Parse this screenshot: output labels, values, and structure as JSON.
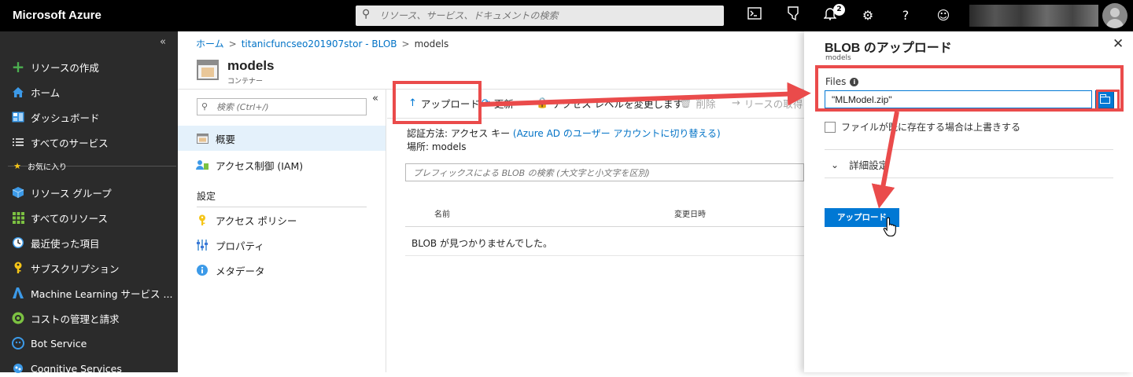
{
  "topbar": {
    "brand": "Microsoft Azure",
    "search_placeholder": "リソース、サービス、ドキュメントの検索",
    "notification_count": "2",
    "icons": [
      "cloud-shell-icon",
      "directory-filter-icon",
      "notifications-icon",
      "settings-icon",
      "help-icon",
      "feedback-icon"
    ]
  },
  "leftnav": {
    "items": [
      {
        "label": "リソースの作成",
        "icon": "plus-icon",
        "color": "#4caf50"
      },
      {
        "label": "ホーム",
        "icon": "home-icon",
        "color": "#3c9ae8"
      },
      {
        "label": "ダッシュボード",
        "icon": "dashboard-icon",
        "color": "#3c9ae8"
      },
      {
        "label": "すべてのサービス",
        "icon": "list-icon",
        "color": "#cccccc"
      },
      {
        "label": "お気に入り",
        "icon": "star-icon",
        "color": "#f5c518"
      },
      {
        "label": "リソース グループ",
        "icon": "resource-group-icon",
        "color": "#3c9ae8"
      },
      {
        "label": "すべてのリソース",
        "icon": "grid-icon",
        "color": "#7cc242"
      },
      {
        "label": "最近使った項目",
        "icon": "clock-icon",
        "color": "#3c9ae8"
      },
      {
        "label": "サブスクリプション",
        "icon": "key-icon",
        "color": "#f5c518"
      },
      {
        "label": "Machine Learning サービス ...",
        "icon": "machine-learning-icon",
        "color": "#3c9ae8"
      },
      {
        "label": "コストの管理と請求",
        "icon": "cost-icon",
        "color": "#7cc242"
      },
      {
        "label": "Bot Service",
        "icon": "bot-icon",
        "color": "#3c9ae8"
      },
      {
        "label": "Cognitive Services",
        "icon": "cognitive-icon",
        "color": "#3c9ae8"
      }
    ]
  },
  "breadcrumb": {
    "home": "ホーム",
    "account": "titanicfuncseo201907stor - BLOB",
    "current": "models"
  },
  "page": {
    "title": "models",
    "subtitle": "コンテナー"
  },
  "resource_menu": {
    "search_placeholder": "検索 (Ctrl+/)",
    "items": [
      {
        "label": "概要",
        "icon": "overview-icon"
      },
      {
        "label": "アクセス制御 (IAM)",
        "icon": "iam-icon"
      }
    ],
    "settings_header": "設定",
    "settings_items": [
      {
        "label": "アクセス ポリシー",
        "icon": "key-icon"
      },
      {
        "label": "プロパティ",
        "icon": "properties-icon"
      },
      {
        "label": "メタデータ",
        "icon": "info-icon"
      }
    ]
  },
  "toolbar": {
    "upload": "アップロード",
    "refresh": "更新",
    "access_level": "アクセス レベルを変更します",
    "delete": "削除",
    "lease": "リースの取得"
  },
  "content": {
    "auth_label": "認証方法: アクセス キー",
    "auth_link": "(Azure AD のユーザー アカウントに切り替える)",
    "location": "場所: models",
    "blob_search_placeholder": "プレフィックスによる BLOB の検索 (大文字と小文字を区別)",
    "columns": [
      "名前",
      "変更日時"
    ],
    "empty_message": "BLOB が見つかりませんでした。"
  },
  "blade": {
    "title": "BLOB のアップロード",
    "subtitle": "models",
    "files_label": "Files",
    "files_value": "\"MLModel.zip\"",
    "overwrite_label": "ファイルが既に存在する場合は上書きする",
    "advanced_label": "詳細設定",
    "upload_button": "アップロード"
  },
  "colors": {
    "azure_blue": "#0078d4",
    "link_blue": "#0072c6",
    "annotation_red": "#ea4b4b",
    "nav_bg": "#2b2b2b"
  }
}
